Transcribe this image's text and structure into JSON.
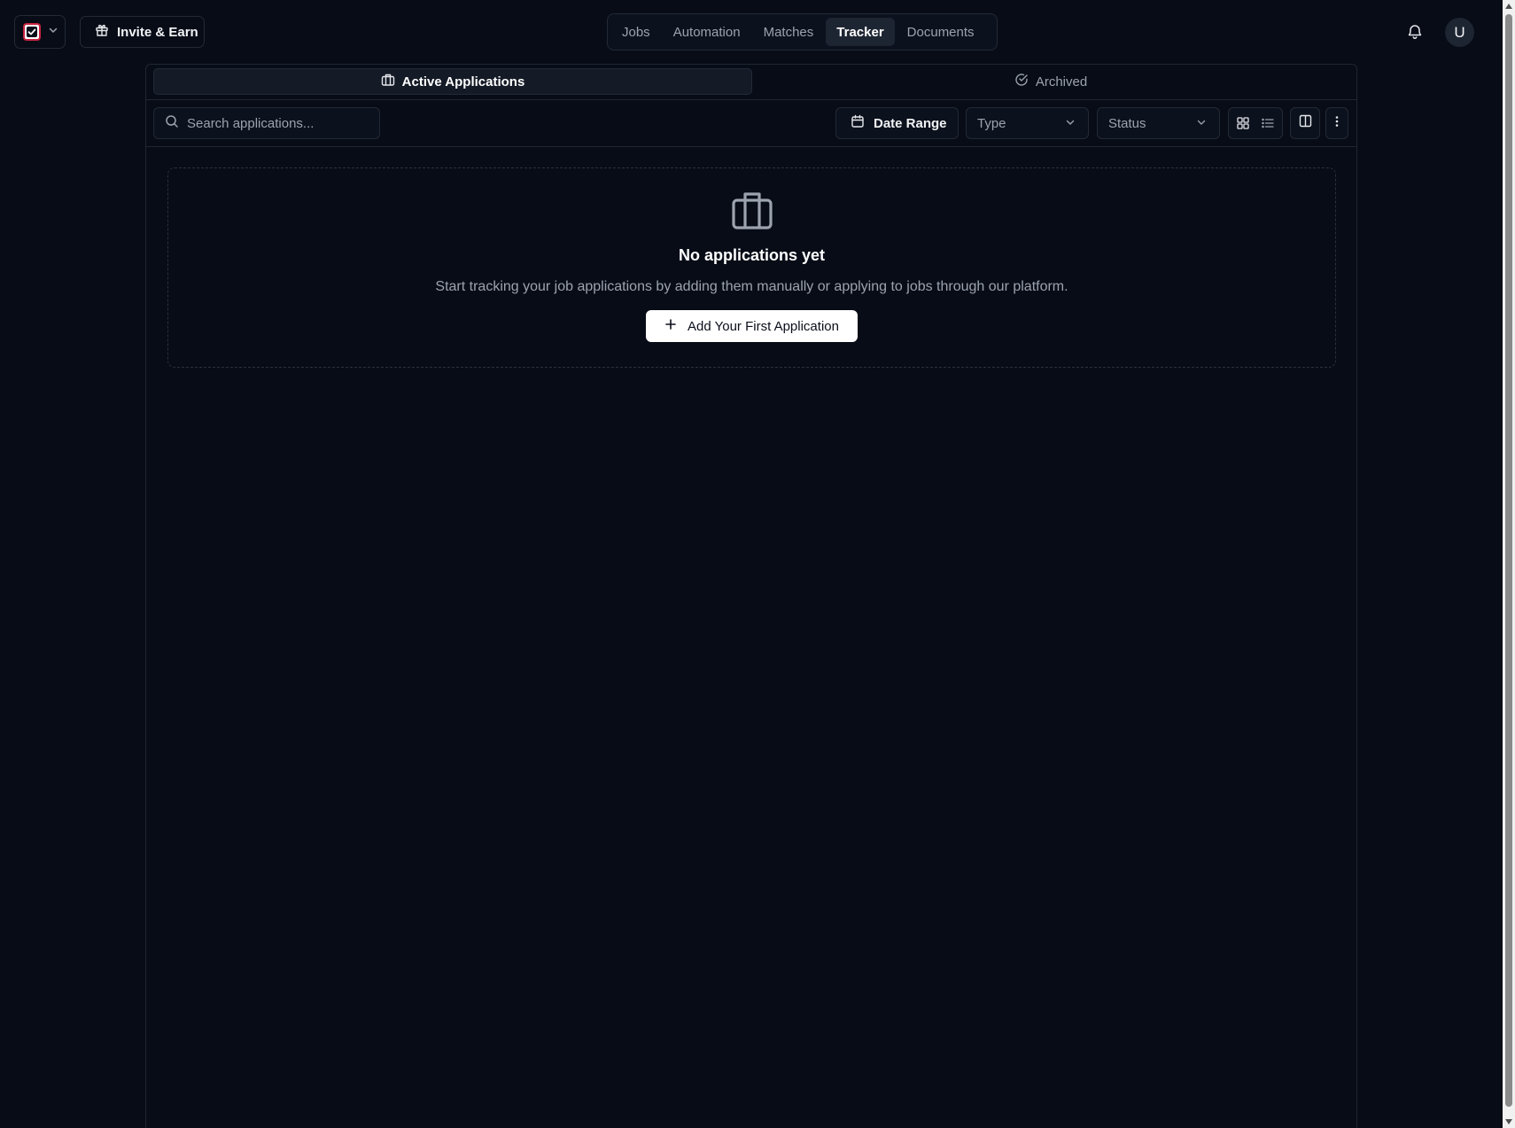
{
  "header": {
    "brand_icon": "checkbox-logo-icon",
    "invite_label": "Invite & Earn",
    "nav": [
      {
        "label": "Jobs",
        "active": false
      },
      {
        "label": "Automation",
        "active": false
      },
      {
        "label": "Matches",
        "active": false
      },
      {
        "label": "Tracker",
        "active": true
      },
      {
        "label": "Documents",
        "active": false
      }
    ],
    "avatar_initial": "U"
  },
  "tabs": [
    {
      "label": "Active Applications",
      "icon": "briefcase-icon",
      "active": true
    },
    {
      "label": "Archived",
      "icon": "check-circle-icon",
      "active": false
    }
  ],
  "toolbar": {
    "search_placeholder": "Search applications...",
    "date_range_label": "Date Range",
    "type_label": "Type",
    "status_label": "Status"
  },
  "empty_state": {
    "icon": "briefcase-icon",
    "title": "No applications yet",
    "description": "Start tracking your job applications by adding them manually or applying to jobs through our platform.",
    "button_label": "Add Your First Application"
  },
  "colors": {
    "background": "#070c17",
    "border": "#232a36",
    "active_nav": "#1e2532",
    "brand_red": "#c8233f"
  }
}
